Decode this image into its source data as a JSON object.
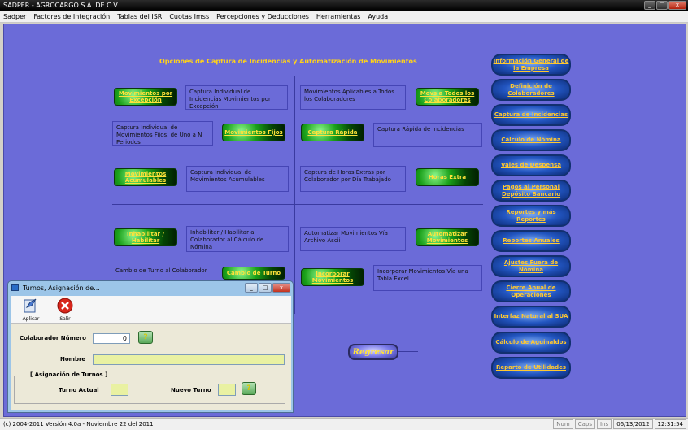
{
  "window": {
    "title": "SADPER - AGROCARGO S.A. DE C.V.",
    "controls": [
      "_",
      "□",
      "x"
    ]
  },
  "menu": [
    "Sadper",
    "Factores de Integración",
    "Tablas del ISR",
    "Cuotas Imss",
    "Percepciones y Deducciones",
    "Herramientas",
    "Ayuda"
  ],
  "main": {
    "heading": "Opciones de Captura de Incidencias y Automatización de Movimientos",
    "left_options": [
      {
        "button": "Movimientos por Excepción",
        "desc": "Captura Individual de Incidencias Movimientos por Excepción"
      },
      {
        "button": "Movimientos Fijos",
        "desc": "Captura Individual de Movimientos Fijos, de Uno a N Periodos"
      },
      {
        "button": "Movimientos Acumulables",
        "desc": "Captura Individual de Movimientos   Acumulables"
      },
      {
        "button": "Inhabilitar / Habilitar",
        "desc": "Inhabilitar / Habilitar al Colaborador al Cálculo de Nómina"
      },
      {
        "button": "Cambio de Turno",
        "desc": "Cambio de Turno al Colaborador"
      }
    ],
    "right_options": [
      {
        "button": "Movs a Todos los Colaboradores",
        "desc": "Movimientos Aplicables a Todos los Colaboradores"
      },
      {
        "button": "Captura Rápida",
        "desc": "Captura Rápida de Incidencias"
      },
      {
        "button": "Horas Extra",
        "desc": "Captura de Horas Extras por Colaborador por Día Trabajado"
      },
      {
        "button": "Automatizar Movimientos",
        "desc": "Automatizar Movimientos Vía Archivo Ascii"
      },
      {
        "button": "Incorporar Movimientos",
        "desc": "Incorporar Movimientos Vía una Tabla Excel"
      }
    ],
    "nav_buttons": [
      "Información General de la Empresa",
      "Definición de Colaboradores",
      "Captura de Incidencias",
      "Cálculo de Nómina",
      "Vales de Despensa",
      "Pagos al Personal Depósito Bancario",
      "Reportes y más Reportes",
      "Reportes Anuales",
      "Ajustes Fuera de Nómina",
      "Cierre Anual de Operaciones",
      "Interfaz Natural al SUA",
      "Cálculo de Aguinaldos",
      "Reparto de Utilidades"
    ],
    "back_button": "Regresar"
  },
  "dialog": {
    "title": "Turnos, Asignación de...",
    "toolbar": {
      "apply": "Aplicar",
      "exit": "Salir"
    },
    "collaborator_label": "Colaborador Número",
    "collaborator_value": "0",
    "name_label": "Nombre",
    "name_value": "",
    "group_title": "[ Asignación de Turnos ]",
    "current_shift_label": "Turno Actual",
    "new_shift_label": "Nuevo Turno",
    "help_glyph": "?"
  },
  "statusbar": {
    "copyright": "(c) 2004-2011   Versión 4.0a - Noviembre 22 del 2011",
    "num": "Num",
    "caps": "Caps",
    "ins": "Ins",
    "date": "06/13/2012",
    "time": "12:31:54"
  }
}
